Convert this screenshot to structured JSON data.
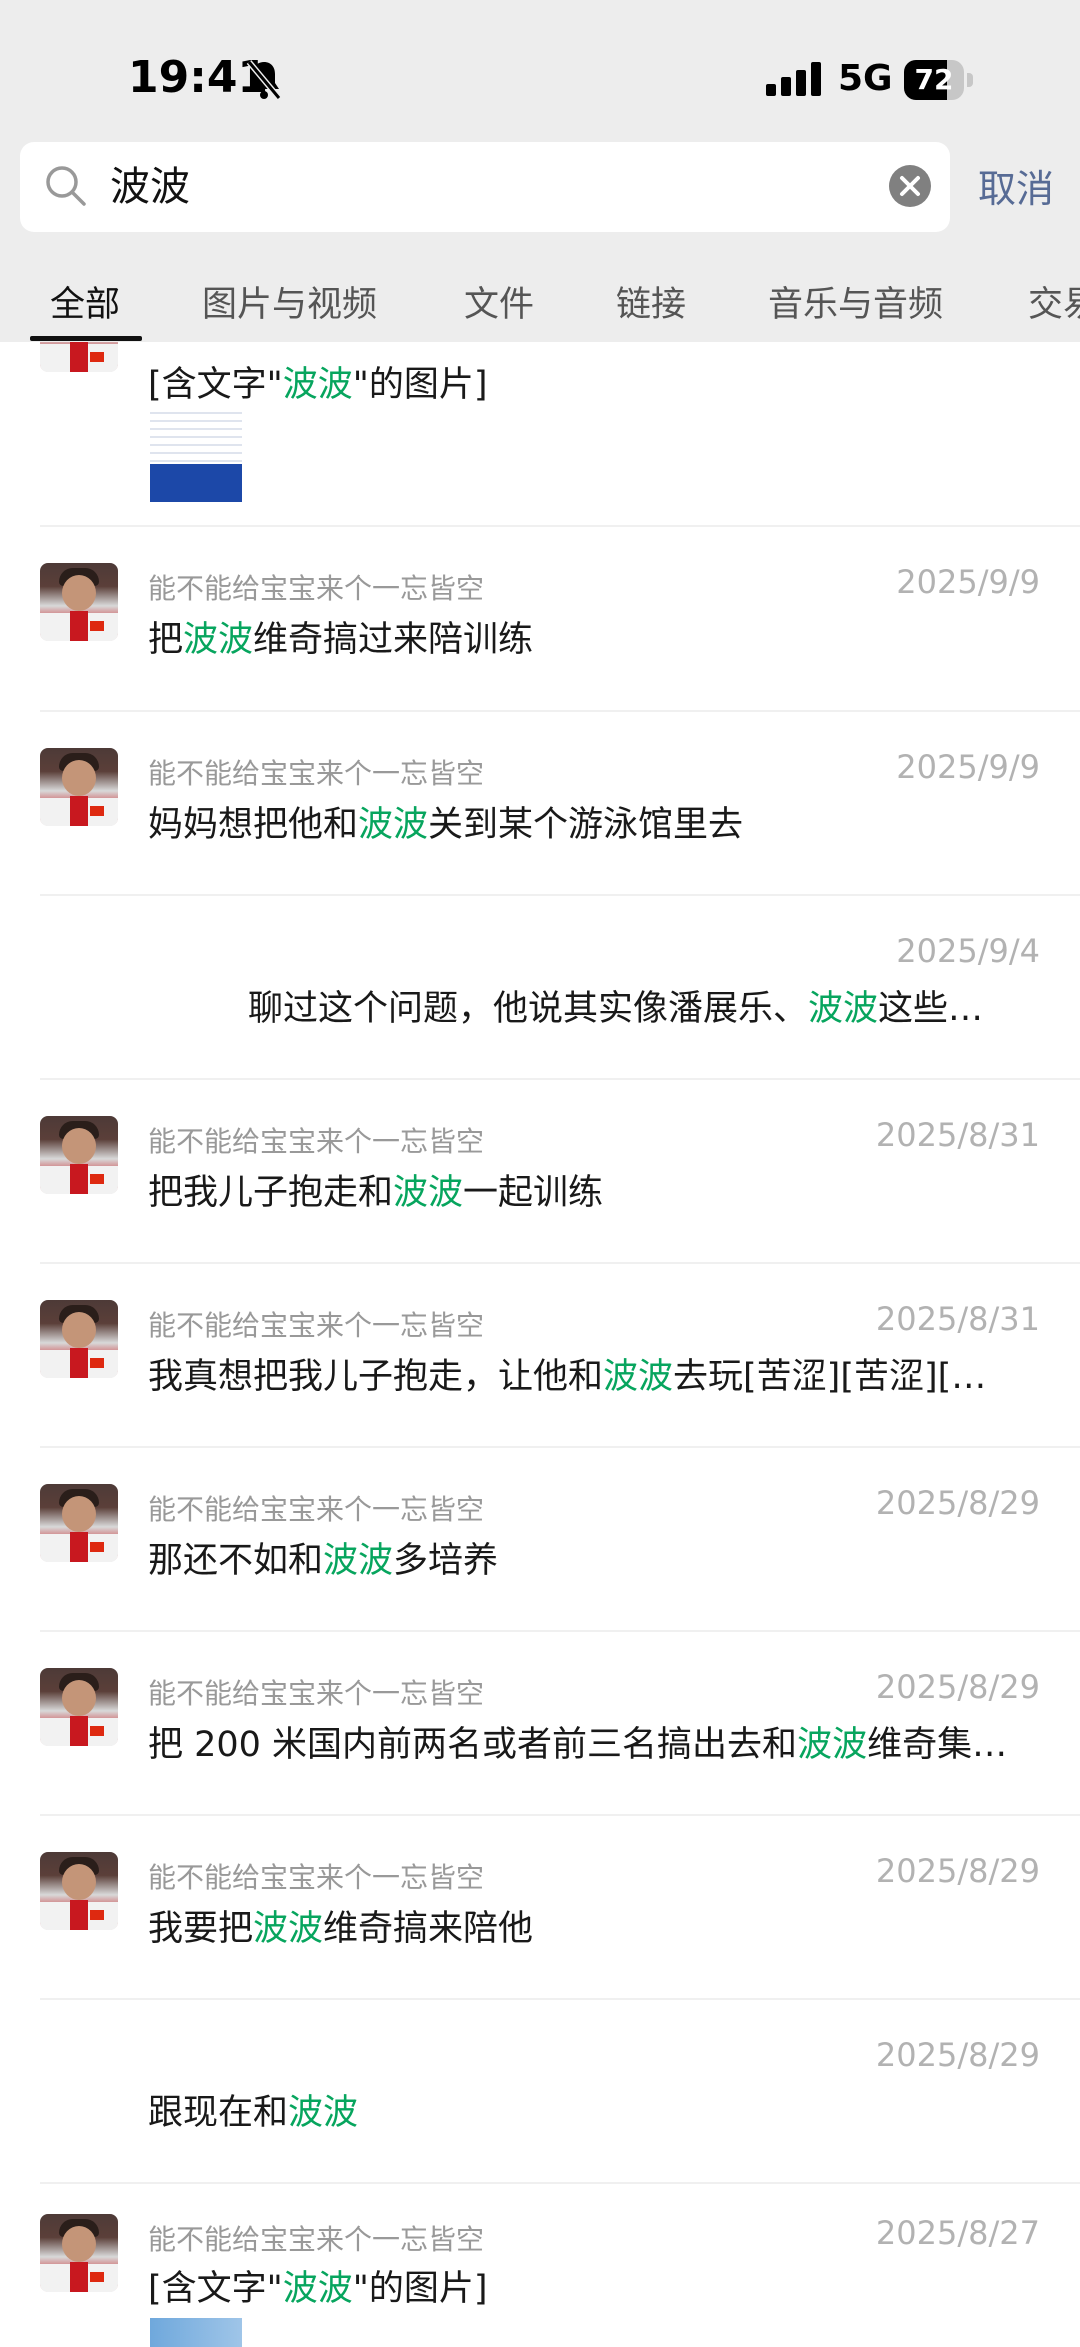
{
  "status_bar": {
    "time": "19:41",
    "network": "5G",
    "battery": "72",
    "battery_level": 0.72
  },
  "search": {
    "query": "波波",
    "cancel_label": "取消"
  },
  "tabs": [
    {
      "label": "全部",
      "active": true
    },
    {
      "label": "图片与视频"
    },
    {
      "label": "文件"
    },
    {
      "label": "链接"
    },
    {
      "label": "音乐与音频"
    },
    {
      "label": "交易"
    }
  ],
  "results": [
    {
      "sender": "",
      "date": "",
      "pre": "[含文字\"",
      "hl": "波波",
      "post": "\"的图片]"
    },
    {
      "sender": "能不能给宝宝来个一忘皆空",
      "date": "2025/9/9",
      "pre": "把",
      "hl": "波波",
      "post": "维奇搞过来陪训练"
    },
    {
      "sender": "能不能给宝宝来个一忘皆空",
      "date": "2025/9/9",
      "pre": "妈妈想把他和",
      "hl": "波波",
      "post": "关到某个游泳馆里去"
    },
    {
      "sender": "",
      "date": "2025/9/4",
      "pre": "聊过这个问题，他说其实像潘展乐、",
      "hl": "波波",
      "post": "这些…"
    },
    {
      "sender": "能不能给宝宝来个一忘皆空",
      "date": "2025/8/31",
      "pre": "把我儿子抱走和",
      "hl": "波波",
      "post": "一起训练"
    },
    {
      "sender": "能不能给宝宝来个一忘皆空",
      "date": "2025/8/31",
      "pre": "我真想把我儿子抱走，让他和",
      "hl": "波波",
      "post": "去玩[苦涩][苦涩][…"
    },
    {
      "sender": "能不能给宝宝来个一忘皆空",
      "date": "2025/8/29",
      "pre": "那还不如和",
      "hl": "波波",
      "post": "多培养"
    },
    {
      "sender": "能不能给宝宝来个一忘皆空",
      "date": "2025/8/29",
      "pre": "把 200 米国内前两名或者前三名搞出去和",
      "hl": "波波",
      "post": "维奇集…"
    },
    {
      "sender": "能不能给宝宝来个一忘皆空",
      "date": "2025/8/29",
      "pre": "我要把",
      "hl": "波波",
      "post": "维奇搞来陪他"
    },
    {
      "sender": "",
      "date": "2025/8/29",
      "pre": "跟现在和",
      "hl": "波波",
      "post": ""
    },
    {
      "sender": "能不能给宝宝来个一忘皆空",
      "date": "2025/8/27",
      "pre": "[含文字\"",
      "hl": "波波",
      "post": "\"的图片]"
    }
  ]
}
